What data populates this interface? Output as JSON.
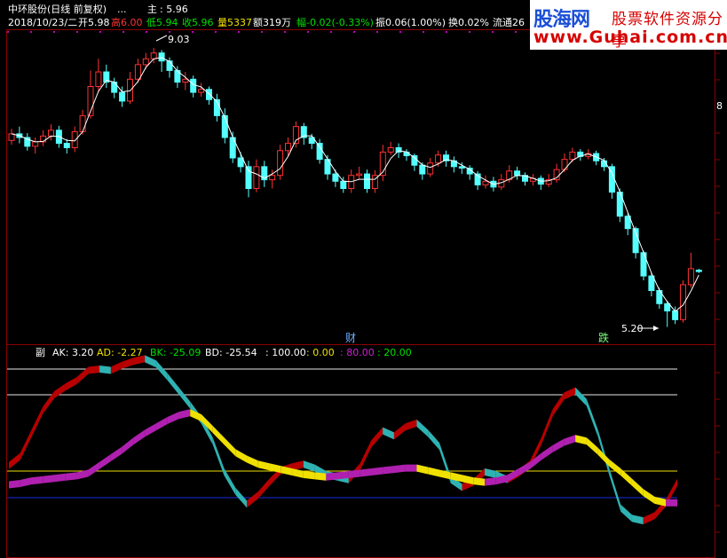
{
  "header": {
    "stock": "中环股份(日线 前复权)",
    "dots": "...",
    "main_label": "主",
    "main_value": ": 5.96",
    "date": "2018/10/23/二",
    "open": "开5.98",
    "high": "高6.00",
    "low": "低5.94",
    "close": "收5.96",
    "volume": "量5337",
    "amount": "额319万",
    "change": "幅-0.02(-0.33%)",
    "amplitude": "振0.06(1.00%)",
    "turnover": "换0.02%",
    "float": "流通26"
  },
  "logo": {
    "brand": "股海网",
    "tagline": "股票软件资源分享",
    "url": "www.Guhai.com.cn"
  },
  "price_labels": {
    "max": "9.03",
    "min": "5.20",
    "axis_tick": "8"
  },
  "markers": {
    "cai": "财",
    "die": "跌"
  },
  "indicator": {
    "name": "副",
    "ak": "AK: 3.20",
    "ad": "AD: -2.27",
    "bk": "BK: -25.09",
    "bd": "BD: -25.54",
    "l100": ": 100.00",
    "l0": ": 0.00",
    "l80": ": 80.00",
    "l20": ": 20.00"
  },
  "colors": {
    "up": "#ff3232",
    "down": "#54ffff",
    "ma": "#ffffff",
    "grid": "#8b0000",
    "rise": "#b80000",
    "fall": "#2fb2b2",
    "magenta": "#b020b0",
    "yellow": "#f0e000",
    "blue": "#1c2ee0"
  },
  "ak_series": [
    25,
    32,
    50,
    68,
    80,
    86,
    91,
    99,
    100,
    99,
    103,
    106,
    108,
    104,
    94,
    83,
    72,
    60,
    44,
    20,
    5,
    -5,
    2,
    12,
    21,
    24,
    26,
    23,
    18,
    16,
    14,
    24,
    42,
    52,
    48,
    55,
    58,
    50,
    40,
    14,
    8,
    12,
    20,
    18,
    14,
    19,
    26,
    44,
    66,
    79,
    83,
    74,
    50,
    20,
    -8,
    -16,
    -18,
    -14,
    -4,
    12
  ],
  "ad_series": [
    10,
    11,
    13,
    14,
    15,
    16,
    17,
    19,
    25,
    31,
    37,
    44,
    50,
    55,
    60,
    64,
    66,
    62,
    53,
    44,
    35,
    30,
    26,
    24,
    22,
    20,
    18,
    17,
    16,
    17,
    18,
    19,
    20,
    21,
    22,
    23,
    23,
    21,
    19,
    17,
    15,
    13,
    12,
    13,
    15,
    20,
    25,
    32,
    38,
    43,
    46,
    44,
    36,
    27,
    20,
    12,
    4,
    -2,
    -4,
    -4
  ],
  "candles": [
    [
      7.76,
      7.85,
      7.92,
      7.7
    ],
    [
      7.85,
      7.8,
      7.95,
      7.72
    ],
    [
      7.8,
      7.68,
      7.86,
      7.62
    ],
    [
      7.68,
      7.74,
      7.8,
      7.58
    ],
    [
      7.74,
      7.82,
      7.9,
      7.68
    ],
    [
      7.82,
      7.9,
      7.98,
      7.76
    ],
    [
      7.9,
      7.72,
      7.96,
      7.66
    ],
    [
      7.72,
      7.66,
      7.78,
      7.58
    ],
    [
      7.66,
      7.88,
      7.95,
      7.6
    ],
    [
      7.88,
      8.1,
      8.18,
      7.84
    ],
    [
      8.1,
      8.5,
      8.72,
      8.06
    ],
    [
      8.5,
      8.7,
      8.88,
      8.42
    ],
    [
      8.7,
      8.56,
      8.8,
      8.48
    ],
    [
      8.56,
      8.42,
      8.62,
      8.34
    ],
    [
      8.42,
      8.3,
      8.5,
      8.22
    ],
    [
      8.3,
      8.6,
      8.7,
      8.26
    ],
    [
      8.6,
      8.8,
      8.88,
      8.55
    ],
    [
      8.8,
      8.88,
      8.96,
      8.74
    ],
    [
      8.88,
      8.96,
      9.03,
      8.82
    ],
    [
      8.96,
      8.85,
      9.0,
      8.7
    ],
    [
      8.85,
      8.72,
      8.9,
      8.62
    ],
    [
      8.72,
      8.56,
      8.78,
      8.48
    ],
    [
      8.56,
      8.6,
      8.7,
      8.45
    ],
    [
      8.6,
      8.42,
      8.65,
      8.35
    ],
    [
      8.42,
      8.46,
      8.55,
      8.36
    ],
    [
      8.46,
      8.32,
      8.5,
      8.25
    ],
    [
      8.32,
      8.1,
      8.4,
      8.02
    ],
    [
      8.1,
      7.8,
      8.2,
      7.72
    ],
    [
      7.8,
      7.52,
      7.88,
      7.45
    ],
    [
      7.52,
      7.4,
      7.6,
      7.32
    ],
    [
      7.4,
      7.1,
      7.48,
      6.98
    ],
    [
      7.1,
      7.4,
      7.5,
      7.05
    ],
    [
      7.4,
      7.22,
      7.48,
      7.12
    ],
    [
      7.22,
      7.28,
      7.36,
      7.1
    ],
    [
      7.28,
      7.62,
      7.7,
      7.22
    ],
    [
      7.62,
      7.72,
      7.8,
      7.55
    ],
    [
      7.72,
      7.95,
      8.02,
      7.66
    ],
    [
      7.95,
      7.8,
      8.0,
      7.7
    ],
    [
      7.8,
      7.72,
      7.85,
      7.64
    ],
    [
      7.72,
      7.5,
      7.78,
      7.44
    ],
    [
      7.5,
      7.3,
      7.56,
      7.22
    ],
    [
      7.3,
      7.2,
      7.36,
      7.12
    ],
    [
      7.2,
      7.1,
      7.26,
      7.04
    ],
    [
      7.1,
      7.28,
      7.36,
      7.04
    ],
    [
      7.28,
      7.3,
      7.4,
      7.22
    ],
    [
      7.3,
      7.1,
      7.36,
      7.04
    ],
    [
      7.1,
      7.28,
      7.35,
      7.04
    ],
    [
      7.28,
      7.6,
      7.7,
      7.2
    ],
    [
      7.6,
      7.66,
      7.74,
      7.56
    ],
    [
      7.66,
      7.6,
      7.72,
      7.52
    ],
    [
      7.6,
      7.55,
      7.64,
      7.48
    ],
    [
      7.55,
      7.42,
      7.58,
      7.34
    ],
    [
      7.42,
      7.3,
      7.46,
      7.22
    ],
    [
      7.3,
      7.45,
      7.52,
      7.26
    ],
    [
      7.45,
      7.56,
      7.62,
      7.4
    ],
    [
      7.56,
      7.48,
      7.62,
      7.4
    ],
    [
      7.48,
      7.4,
      7.54,
      7.32
    ],
    [
      7.4,
      7.38,
      7.46,
      7.3
    ],
    [
      7.38,
      7.3,
      7.42,
      7.22
    ],
    [
      7.3,
      7.15,
      7.34,
      7.08
    ],
    [
      7.15,
      7.2,
      7.28,
      7.1
    ],
    [
      7.2,
      7.12,
      7.26,
      7.06
    ],
    [
      7.12,
      7.22,
      7.3,
      7.08
    ],
    [
      7.22,
      7.34,
      7.42,
      7.18
    ],
    [
      7.34,
      7.28,
      7.4,
      7.22
    ],
    [
      7.28,
      7.2,
      7.32,
      7.14
    ],
    [
      7.2,
      7.24,
      7.3,
      7.14
    ],
    [
      7.24,
      7.16,
      7.28,
      7.08
    ],
    [
      7.16,
      7.22,
      7.3,
      7.12
    ],
    [
      7.22,
      7.36,
      7.44,
      7.18
    ],
    [
      7.36,
      7.5,
      7.58,
      7.32
    ],
    [
      7.5,
      7.6,
      7.66,
      7.46
    ],
    [
      7.6,
      7.54,
      7.64,
      7.48
    ],
    [
      7.54,
      7.58,
      7.64,
      7.5
    ],
    [
      7.58,
      7.48,
      7.62,
      7.42
    ],
    [
      7.48,
      7.4,
      7.52,
      7.34
    ],
    [
      7.4,
      7.05,
      7.44,
      6.96
    ],
    [
      7.05,
      6.72,
      7.1,
      6.64
    ],
    [
      6.72,
      6.55,
      6.76,
      6.46
    ],
    [
      6.55,
      6.22,
      6.58,
      6.14
    ],
    [
      6.22,
      5.9,
      6.25,
      5.84
    ],
    [
      5.9,
      5.7,
      5.95,
      5.62
    ],
    [
      5.7,
      5.52,
      5.74,
      5.45
    ],
    [
      5.52,
      5.42,
      5.56,
      5.2
    ],
    [
      5.42,
      5.3,
      5.48,
      5.24
    ],
    [
      5.3,
      5.78,
      5.84,
      5.26
    ],
    [
      5.78,
      6.0,
      6.22,
      5.74
    ],
    [
      5.98,
      5.96,
      6.0,
      5.94
    ]
  ]
}
